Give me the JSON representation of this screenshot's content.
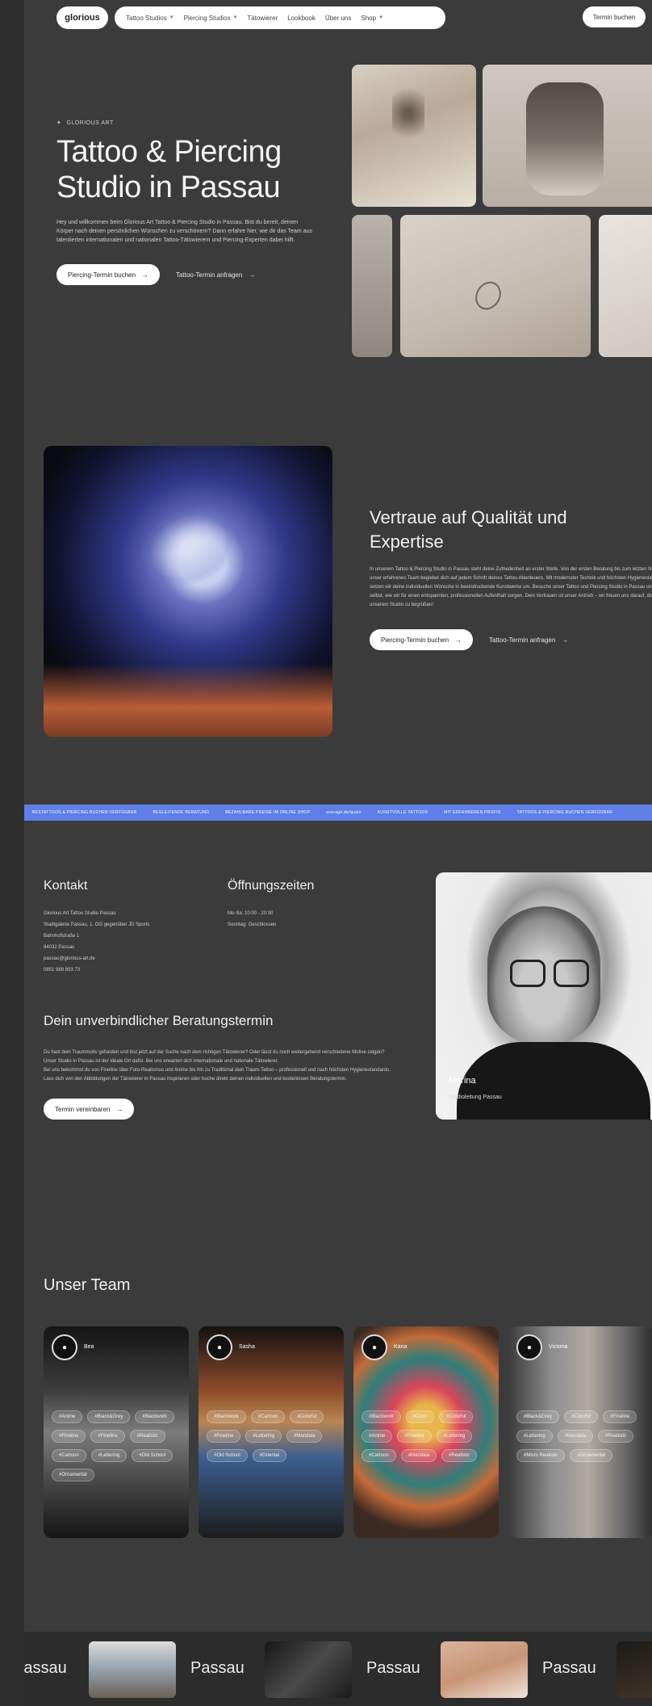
{
  "nav": {
    "logo": "glorious",
    "items": [
      {
        "label": "Tattoo Studios",
        "chevron": true
      },
      {
        "label": "Piercing Studios",
        "chevron": true
      },
      {
        "label": "Tätowierer",
        "chevron": false
      },
      {
        "label": "Lookbook",
        "chevron": false
      },
      {
        "label": "Über uns",
        "chevron": false
      },
      {
        "label": "Shop",
        "chevron": true
      }
    ],
    "cta": "Termin buchen"
  },
  "hero": {
    "eyebrow": "GLORIOUS ART",
    "title_line1": "Tattoo & Piercing",
    "title_line2": "Studio in Passau",
    "text": "Hey und willkommen beim Glorious Art Tattoo & Piercing Studio in Passau. Bist du bereit, deinen Körper nach deinen persönlichen Wünschen zu verschönern? Dann erfahre hier, wie dir das Team aus talentierten internationalen und nationalen Tattoo-Tätowierern und Piercing-Experten dabei hilft.",
    "primary_button": "Piercing-Termin buchen",
    "secondary_button": "Tattoo-Termin anfragen"
  },
  "quality": {
    "title_line1": "Vertraue auf Qualität und",
    "title_line2": "Expertise",
    "text": "In unserem Tattoo & Piercing Studio in Passau steht deine Zufriedenheit an erster Stelle. Von der ersten Beratung bis zum letzten Nadelstich – unser erfahrenes Team begleitet dich auf jedem Schritt deines Tattoo-Abenteuers. Mit modernster Technik und höchsten Hygienestandards setzen wir deine individuellen Wünsche in beeindruckende Kunstwerke um. Besuche unser Tattoo und Piercing Studio in Passau und entdecke selbst, wie wir für einen entspannten, professionellen Aufenthalt sorgen. Dein Vertrauen ist unser Antrieb – wir freuen uns darauf, dich in unserem Studio zu begrüßen!",
    "primary_button": "Piercing-Termin buchen",
    "secondary_button": "Tattoo-Termin anfragen"
  },
  "marquee": [
    "BESTATTOOS & PIERCING BUCHEN VERFÜGBAR",
    "BEGLEITENDE BERATUNG",
    "BEZAHLBARE PREISE IM ONLINE SHOP",
    "average.de/quale",
    "KUNSTVOLLE TATTOOS",
    "MIT ERFAHRENEN PROFIS",
    "TATTOOS & PIERCING BUCHEN VERFÜGBAR"
  ],
  "contact": {
    "title": "Kontakt",
    "lines": [
      "Glorious Art Tattoo Studio Passau",
      "Stadtgalerie Passau, 1. OG gegenüber JD Sports",
      "Bahnhofstraße 1",
      "94032 Passau",
      "passau@glorious-art.de",
      "0851 989 803 73"
    ]
  },
  "hours": {
    "title": "Öffnungszeiten",
    "lines": [
      "Mo-Sa: 10:00 - 20:00",
      "Sonntag: Geschlossen"
    ]
  },
  "consult": {
    "title": "Dein unverbindlicher Beratungstermin",
    "paragraphs": [
      "Du hast dein Traummotiv gefunden und bist jetzt auf der Suche nach dem richtigen Tätowierer? Oder lässt du noch weitergehend verschiedene Motive zeigen? Unser Studio in Passau ist der ideale Ort dafür. Bei uns erwarten dich internationale und nationale Tätowierer.",
      "Bei uns bekommst du von Fineline über Foto-Realismus und Anime bis hin zu Traditional dein Traum-Tattoo – professionell und nach höchsten Hygienestandards.",
      "Lass dich von den Abbildungen der Tätowierer in Passau inspirieren oder buche direkt deinen individuellen und kostenlosen Beratungstermin."
    ],
    "button": "Termin vereinbaren"
  },
  "portrait": {
    "name": "Marina",
    "role": "Studioleitung Passau"
  },
  "team": {
    "title": "Unser Team",
    "members": [
      {
        "name": "Bea",
        "tags": [
          "#Anime",
          "#Black&Grey",
          "#Blackwork",
          "#Fineline",
          "#Fineline",
          "#Realistic",
          "#Cartoon",
          "#Lettering",
          "#Old School",
          "#Ornamental"
        ]
      },
      {
        "name": "Sasha",
        "tags": [
          "#Blackwork",
          "#Cartoon",
          "#Colorful",
          "#Fineline",
          "#Lettering",
          "#Mandala",
          "#Old School",
          "#Oriental"
        ]
      },
      {
        "name": "Kana",
        "tags": [
          "#Blackwork",
          "#Color",
          "#Colorful",
          "#Anime",
          "#Fineline",
          "#Lettering",
          "#Cartoon",
          "#Mandala",
          "#Realistic"
        ]
      },
      {
        "name": "Victoria",
        "tags": [
          "#Black&Grey",
          "#Colorful",
          "#Fineline",
          "#Lettering",
          "#Mandala",
          "#Realistic",
          "#Micro Realistic",
          "#Ornamental"
        ]
      }
    ]
  },
  "strip": {
    "words": [
      "Passau",
      "Passau",
      "Passau",
      "Passau"
    ]
  }
}
